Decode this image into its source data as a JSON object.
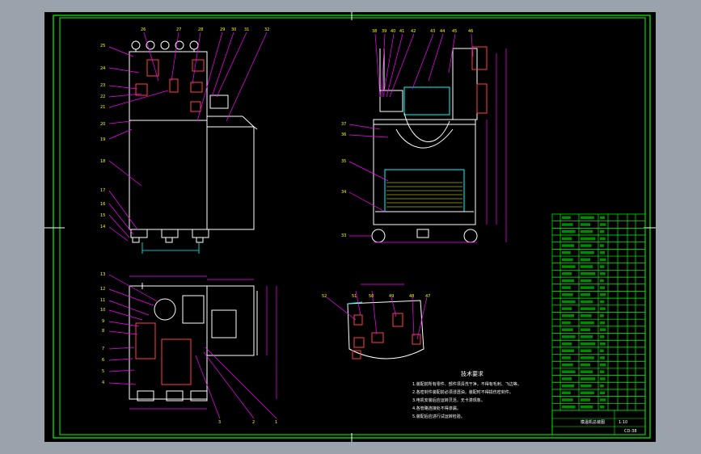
{
  "colors": {
    "outer": "#9aa3ab",
    "paper": "#000000",
    "frame": "#00ff00",
    "line": "#ffffff",
    "leader": "#ff00ff",
    "dim": "#00ffff",
    "part": "#ffff00",
    "title_block": "#00ff00",
    "notes": "#ffffff",
    "cyan": "#00ffff"
  },
  "notes": {
    "heading": "技术要求",
    "lines": [
      "1.装配前所有零件、部件须清洗干净，不得有毛刺、飞边等。",
      "2.各密封件装配前必须浸透油，装配时不得损伤密封件。",
      "3.电机安装后应运转灵活，无卡滞现象。",
      "4.各管路连接处不得渗漏。",
      "5.装配后应进行试运转检验。"
    ]
  },
  "title_block": {
    "drawing_no": "CD-38",
    "title": "模温机总装图",
    "scale": "1:10"
  },
  "balloons": {
    "front": [
      "25",
      "24",
      "23",
      "22",
      "21",
      "20",
      "19",
      "18",
      "17",
      "16",
      "15",
      "14",
      "26",
      "27",
      "28",
      "29",
      "30",
      "31",
      "32"
    ],
    "side": [
      "38",
      "39",
      "40",
      "41",
      "42",
      "43",
      "44",
      "45",
      "46",
      "37",
      "36",
      "35",
      "34",
      "33"
    ],
    "top": [
      "13",
      "12",
      "11",
      "10",
      "9",
      "8",
      "7",
      "6",
      "5",
      "4",
      "3",
      "2",
      "1"
    ],
    "panel": [
      "52",
      "51",
      "50",
      "49",
      "48",
      "47"
    ]
  }
}
